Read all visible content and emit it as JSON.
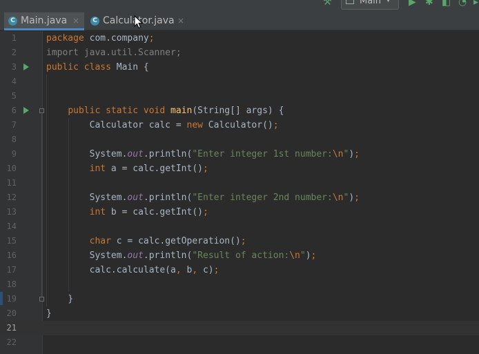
{
  "toolbar": {
    "run_config_label": "Main",
    "build_icon": "hammer-icon",
    "run_icon": "play-icon",
    "debug_icon": "bug-icon",
    "coverage_icon": "coverage-icon",
    "profile_icon": "profile-icon"
  },
  "tabs": [
    {
      "label": "Main.java",
      "icon": "class-icon",
      "close": "×",
      "active": true
    },
    {
      "label": "Calculator.java",
      "icon": "class-icon",
      "close": "×",
      "active": false
    }
  ],
  "editor": {
    "current_line": 21,
    "lines": [
      {
        "n": "1",
        "text": "package com.company;"
      },
      {
        "n": "2",
        "text": "import java.util.Scanner;"
      },
      {
        "n": "3",
        "text": "public class Main {"
      },
      {
        "n": "4",
        "text": ""
      },
      {
        "n": "5",
        "text": ""
      },
      {
        "n": "6",
        "text": "    public static void main(String[] args) {"
      },
      {
        "n": "7",
        "text": "        Calculator calc = new Calculator();"
      },
      {
        "n": "8",
        "text": ""
      },
      {
        "n": "9",
        "text": "        System.out.println(\"Enter integer 1st number:\\n\");"
      },
      {
        "n": "10",
        "text": "        int a = calc.getInt();"
      },
      {
        "n": "11",
        "text": ""
      },
      {
        "n": "12",
        "text": "        System.out.println(\"Enter integer 2nd number:\\n\");"
      },
      {
        "n": "13",
        "text": "        int b = calc.getInt();"
      },
      {
        "n": "14",
        "text": ""
      },
      {
        "n": "15",
        "text": "        char c = calc.getOperation();"
      },
      {
        "n": "16",
        "text": "        System.out.println(\"Result of action:\\n\");"
      },
      {
        "n": "17",
        "text": "        calc.calculate(a, b, c);"
      },
      {
        "n": "18",
        "text": ""
      },
      {
        "n": "19",
        "text": "    }"
      },
      {
        "n": "20",
        "text": "}"
      },
      {
        "n": "21",
        "text": ""
      },
      {
        "n": "22",
        "text": ""
      }
    ]
  },
  "colors": {
    "keyword": "#cc7832",
    "method": "#ffc66d",
    "string": "#6a8759",
    "static_field": "#9876aa",
    "background": "#2b2b2b",
    "tab_underline": "#4a88c7"
  }
}
